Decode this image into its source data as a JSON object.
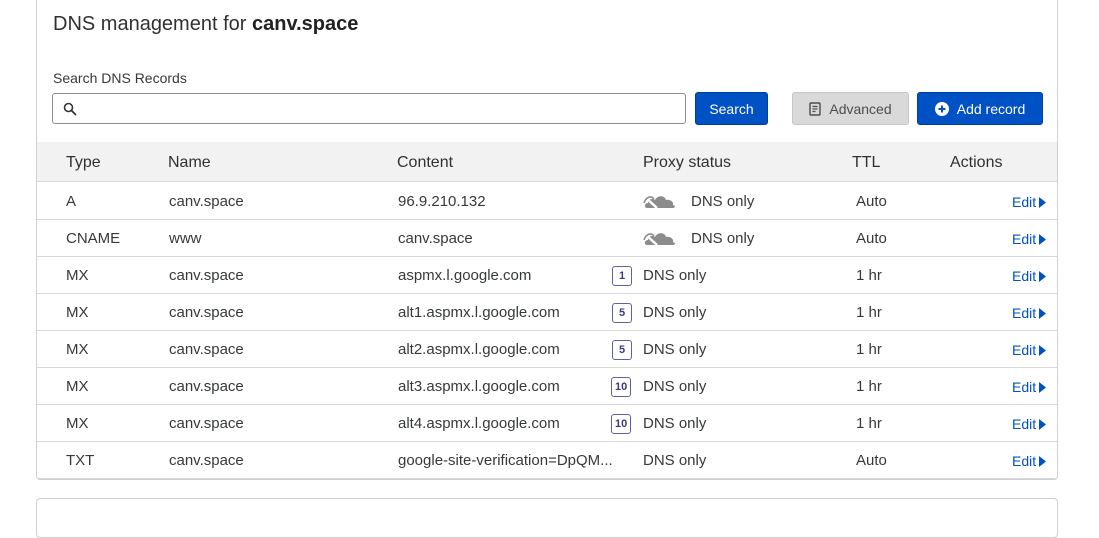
{
  "header": {
    "title_prefix": "DNS management for",
    "domain": "canv.space"
  },
  "search": {
    "label": "Search DNS Records",
    "value": "",
    "placeholder": "",
    "search_button": "Search",
    "advanced_button": "Advanced",
    "add_record_button": "Add record"
  },
  "table": {
    "columns": {
      "type": "Type",
      "name": "Name",
      "content": "Content",
      "proxy": "Proxy status",
      "ttl": "TTL",
      "actions": "Actions"
    },
    "edit_label": "Edit",
    "rows": [
      {
        "type": "A",
        "name": "canv.space",
        "content": "96.9.210.132",
        "priority": "",
        "proxy": "DNS only",
        "ttl": "Auto"
      },
      {
        "type": "CNAME",
        "name": "www",
        "content": "canv.space",
        "priority": "",
        "proxy": "DNS only",
        "ttl": "Auto"
      },
      {
        "type": "MX",
        "name": "canv.space",
        "content": "aspmx.l.google.com",
        "priority": "1",
        "proxy": "DNS only",
        "ttl": "1 hr"
      },
      {
        "type": "MX",
        "name": "canv.space",
        "content": "alt1.aspmx.l.google.com",
        "priority": "5",
        "proxy": "DNS only",
        "ttl": "1 hr"
      },
      {
        "type": "MX",
        "name": "canv.space",
        "content": "alt2.aspmx.l.google.com",
        "priority": "5",
        "proxy": "DNS only",
        "ttl": "1 hr"
      },
      {
        "type": "MX",
        "name": "canv.space",
        "content": "alt3.aspmx.l.google.com",
        "priority": "10",
        "proxy": "DNS only",
        "ttl": "1 hr"
      },
      {
        "type": "MX",
        "name": "canv.space",
        "content": "alt4.aspmx.l.google.com",
        "priority": "10",
        "proxy": "DNS only",
        "ttl": "1 hr"
      },
      {
        "type": "TXT",
        "name": "canv.space",
        "content": "google-site-verification=DpQM...",
        "priority": "",
        "proxy": "DNS only",
        "ttl": "Auto"
      }
    ]
  },
  "colors": {
    "primary": "#0051c3",
    "header_bg": "#f2f2f2",
    "cloud_gray": "#8c8c8c"
  },
  "icons": {
    "search": "search-icon",
    "advanced": "document-icon",
    "add": "plus-circle-icon",
    "proxy_off": "grey-cloud-icon",
    "edit": "caret-right-icon"
  }
}
